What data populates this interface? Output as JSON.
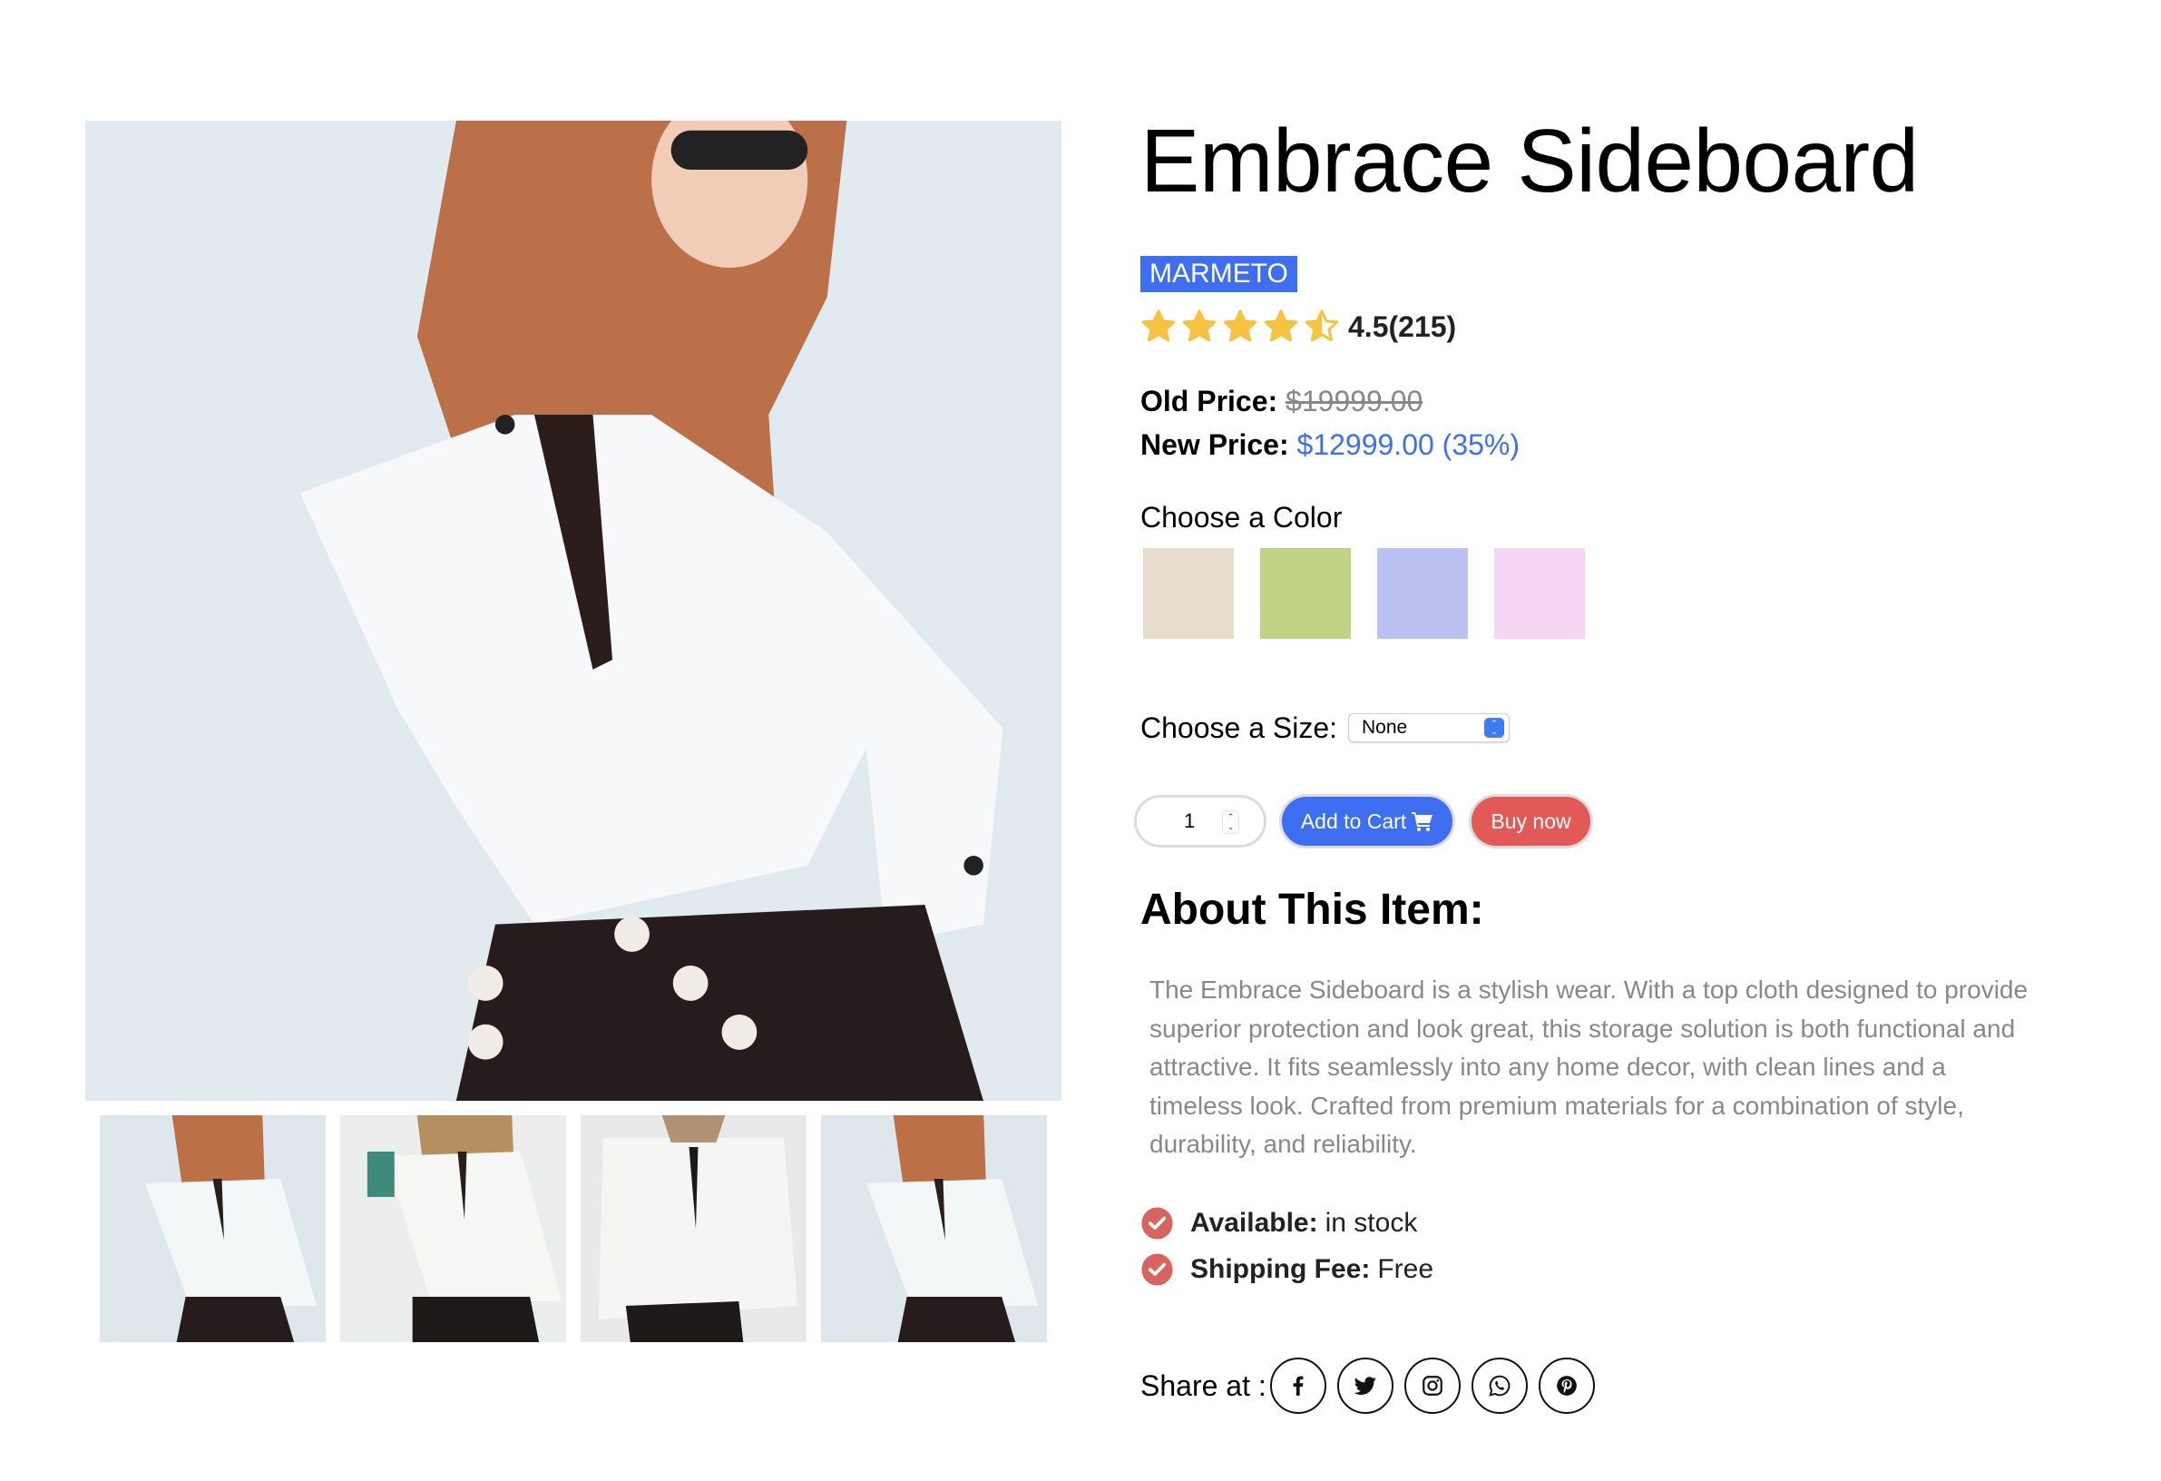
{
  "product": {
    "title": "Embrace Sideboard",
    "brand": "MARMETO",
    "rating": {
      "value": 4.5,
      "max": 5,
      "text": "4.5(215)"
    },
    "price": {
      "old_label": "Old Price:",
      "old_value": "$19999.00",
      "new_label": "New Price:",
      "new_value": "$12999.00 (35%)"
    }
  },
  "gallery": {
    "main_alt": "Woman in white blouse with black tie and black buttoned skirt",
    "thumbnails": [
      {
        "alt": "Thumbnail 1 - model with sunglasses"
      },
      {
        "alt": "Thumbnail 2 - model holding bag"
      },
      {
        "alt": "Thumbnail 3 - blouse close-up"
      },
      {
        "alt": "Thumbnail 4 - model with sunglasses"
      }
    ]
  },
  "color": {
    "label": "Choose a Color",
    "options": [
      "#E8DDCD",
      "#BFD286",
      "#BBC1F0",
      "#F5D5F3"
    ]
  },
  "size": {
    "label": "Choose a Size:",
    "selected": "None"
  },
  "actions": {
    "quantity": "1",
    "add_to_cart": "Add to Cart",
    "buy_now": "Buy now"
  },
  "about": {
    "heading": "About This Item:",
    "text": "The Embrace Sideboard is a stylish wear. With a top cloth designed to provide superior protection and look great, this storage solution is both functional and attractive. It fits seamlessly into any home decor, with clean lines and a timeless look. Crafted from premium materials for a combination of style, durability, and reliability."
  },
  "features": [
    {
      "label": "Available:",
      "value": "in stock"
    },
    {
      "label": "Shipping Fee:",
      "value": "Free"
    }
  ],
  "share": {
    "label": "Share at :",
    "networks": [
      "facebook",
      "twitter",
      "instagram",
      "whatsapp",
      "pinterest"
    ]
  },
  "colors": {
    "accent": "#3F6FF0",
    "buy": "#E25A57",
    "star": "#F5C242",
    "check": "#D9645F",
    "muted_text": "#888888"
  }
}
